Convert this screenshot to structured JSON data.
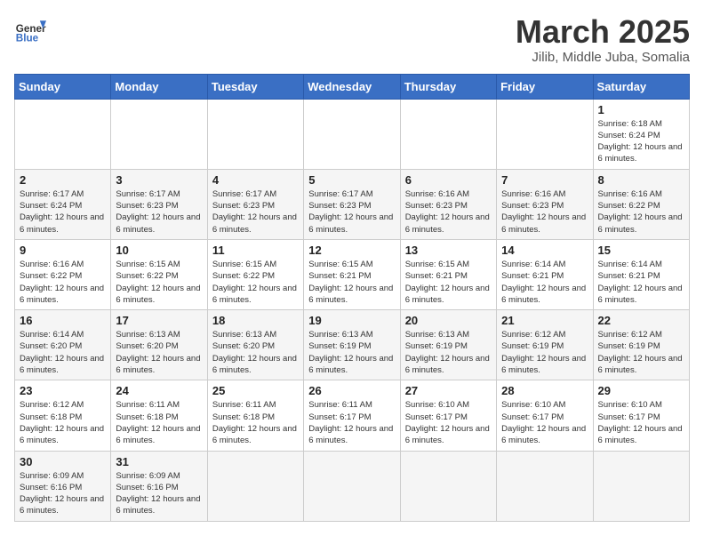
{
  "header": {
    "logo_text_top": "General",
    "logo_text_bottom": "Blue",
    "month_title": "March 2025",
    "subtitle": "Jilib, Middle Juba, Somalia"
  },
  "weekdays": [
    "Sunday",
    "Monday",
    "Tuesday",
    "Wednesday",
    "Thursday",
    "Friday",
    "Saturday"
  ],
  "weeks": [
    [
      {
        "day": "",
        "info": ""
      },
      {
        "day": "",
        "info": ""
      },
      {
        "day": "",
        "info": ""
      },
      {
        "day": "",
        "info": ""
      },
      {
        "day": "",
        "info": ""
      },
      {
        "day": "",
        "info": ""
      },
      {
        "day": "1",
        "info": "Sunrise: 6:18 AM\nSunset: 6:24 PM\nDaylight: 12 hours and 6 minutes."
      }
    ],
    [
      {
        "day": "2",
        "info": "Sunrise: 6:17 AM\nSunset: 6:24 PM\nDaylight: 12 hours and 6 minutes."
      },
      {
        "day": "3",
        "info": "Sunrise: 6:17 AM\nSunset: 6:23 PM\nDaylight: 12 hours and 6 minutes."
      },
      {
        "day": "4",
        "info": "Sunrise: 6:17 AM\nSunset: 6:23 PM\nDaylight: 12 hours and 6 minutes."
      },
      {
        "day": "5",
        "info": "Sunrise: 6:17 AM\nSunset: 6:23 PM\nDaylight: 12 hours and 6 minutes."
      },
      {
        "day": "6",
        "info": "Sunrise: 6:16 AM\nSunset: 6:23 PM\nDaylight: 12 hours and 6 minutes."
      },
      {
        "day": "7",
        "info": "Sunrise: 6:16 AM\nSunset: 6:23 PM\nDaylight: 12 hours and 6 minutes."
      },
      {
        "day": "8",
        "info": "Sunrise: 6:16 AM\nSunset: 6:22 PM\nDaylight: 12 hours and 6 minutes."
      }
    ],
    [
      {
        "day": "9",
        "info": "Sunrise: 6:16 AM\nSunset: 6:22 PM\nDaylight: 12 hours and 6 minutes."
      },
      {
        "day": "10",
        "info": "Sunrise: 6:15 AM\nSunset: 6:22 PM\nDaylight: 12 hours and 6 minutes."
      },
      {
        "day": "11",
        "info": "Sunrise: 6:15 AM\nSunset: 6:22 PM\nDaylight: 12 hours and 6 minutes."
      },
      {
        "day": "12",
        "info": "Sunrise: 6:15 AM\nSunset: 6:21 PM\nDaylight: 12 hours and 6 minutes."
      },
      {
        "day": "13",
        "info": "Sunrise: 6:15 AM\nSunset: 6:21 PM\nDaylight: 12 hours and 6 minutes."
      },
      {
        "day": "14",
        "info": "Sunrise: 6:14 AM\nSunset: 6:21 PM\nDaylight: 12 hours and 6 minutes."
      },
      {
        "day": "15",
        "info": "Sunrise: 6:14 AM\nSunset: 6:21 PM\nDaylight: 12 hours and 6 minutes."
      }
    ],
    [
      {
        "day": "16",
        "info": "Sunrise: 6:14 AM\nSunset: 6:20 PM\nDaylight: 12 hours and 6 minutes."
      },
      {
        "day": "17",
        "info": "Sunrise: 6:13 AM\nSunset: 6:20 PM\nDaylight: 12 hours and 6 minutes."
      },
      {
        "day": "18",
        "info": "Sunrise: 6:13 AM\nSunset: 6:20 PM\nDaylight: 12 hours and 6 minutes."
      },
      {
        "day": "19",
        "info": "Sunrise: 6:13 AM\nSunset: 6:19 PM\nDaylight: 12 hours and 6 minutes."
      },
      {
        "day": "20",
        "info": "Sunrise: 6:13 AM\nSunset: 6:19 PM\nDaylight: 12 hours and 6 minutes."
      },
      {
        "day": "21",
        "info": "Sunrise: 6:12 AM\nSunset: 6:19 PM\nDaylight: 12 hours and 6 minutes."
      },
      {
        "day": "22",
        "info": "Sunrise: 6:12 AM\nSunset: 6:19 PM\nDaylight: 12 hours and 6 minutes."
      }
    ],
    [
      {
        "day": "23",
        "info": "Sunrise: 6:12 AM\nSunset: 6:18 PM\nDaylight: 12 hours and 6 minutes."
      },
      {
        "day": "24",
        "info": "Sunrise: 6:11 AM\nSunset: 6:18 PM\nDaylight: 12 hours and 6 minutes."
      },
      {
        "day": "25",
        "info": "Sunrise: 6:11 AM\nSunset: 6:18 PM\nDaylight: 12 hours and 6 minutes."
      },
      {
        "day": "26",
        "info": "Sunrise: 6:11 AM\nSunset: 6:17 PM\nDaylight: 12 hours and 6 minutes."
      },
      {
        "day": "27",
        "info": "Sunrise: 6:10 AM\nSunset: 6:17 PM\nDaylight: 12 hours and 6 minutes."
      },
      {
        "day": "28",
        "info": "Sunrise: 6:10 AM\nSunset: 6:17 PM\nDaylight: 12 hours and 6 minutes."
      },
      {
        "day": "29",
        "info": "Sunrise: 6:10 AM\nSunset: 6:17 PM\nDaylight: 12 hours and 6 minutes."
      }
    ],
    [
      {
        "day": "30",
        "info": "Sunrise: 6:09 AM\nSunset: 6:16 PM\nDaylight: 12 hours and 6 minutes."
      },
      {
        "day": "31",
        "info": "Sunrise: 6:09 AM\nSunset: 6:16 PM\nDaylight: 12 hours and 6 minutes."
      },
      {
        "day": "",
        "info": ""
      },
      {
        "day": "",
        "info": ""
      },
      {
        "day": "",
        "info": ""
      },
      {
        "day": "",
        "info": ""
      },
      {
        "day": "",
        "info": ""
      }
    ]
  ]
}
